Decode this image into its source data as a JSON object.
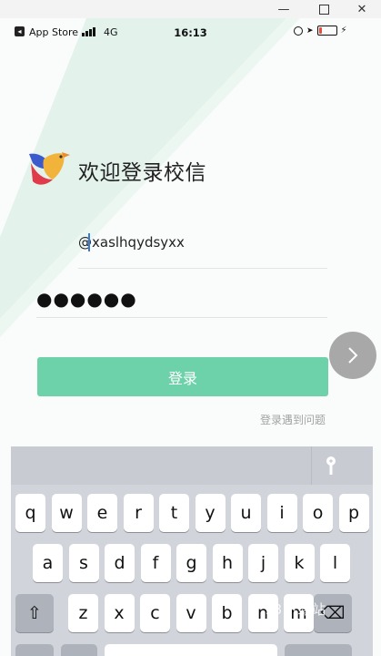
{
  "window": {
    "min_icon": "minimize-icon",
    "max_icon": "maximize-icon",
    "close_icon": "close-icon"
  },
  "status_bar": {
    "back_app": "App Store",
    "network": "4G",
    "time": "16:13",
    "battery_level": 0.18
  },
  "login": {
    "welcome": "欢迎登录校信",
    "username_value": "@xaslhqydsyxx",
    "password_dots": "●●●●●●",
    "login_button": "登录",
    "help_link": "登录遇到问题",
    "next_icon": "chevron-right-icon"
  },
  "colors": {
    "accent": "#6dd1a9",
    "diagonal": "#e3f3ec"
  },
  "keyboard": {
    "row1": [
      "q",
      "w",
      "e",
      "r",
      "t",
      "y",
      "u",
      "i",
      "o",
      "p"
    ],
    "row2": [
      "a",
      "s",
      "d",
      "f",
      "g",
      "h",
      "j",
      "k",
      "l"
    ],
    "row3": [
      "z",
      "x",
      "c",
      "v",
      "b",
      "n",
      "m"
    ],
    "shift": "⇧",
    "delete": "⌫"
  },
  "watermark": "78下载站"
}
